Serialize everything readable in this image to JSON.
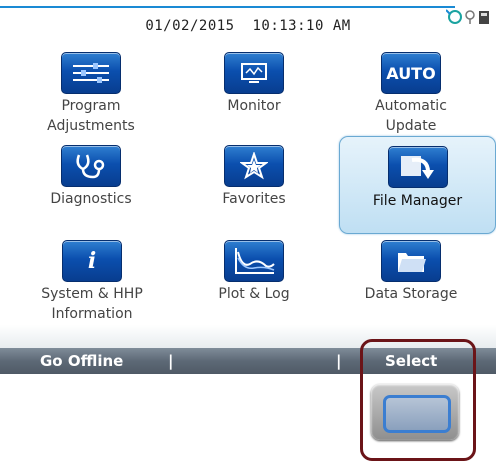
{
  "status": {
    "datetime": "01/02/2015  10:13:10 AM"
  },
  "tiles": [
    {
      "label": "Program\nAdjustments",
      "icon": "sliders-icon"
    },
    {
      "label": "Monitor",
      "icon": "monitor-icon"
    },
    {
      "label": "Automatic\nUpdate",
      "icon": "auto-icon",
      "icon_text": "AUTO"
    },
    {
      "label": "Diagnostics",
      "icon": "stethoscope-icon"
    },
    {
      "label": "Favorites",
      "icon": "star-icon"
    },
    {
      "label": "File Manager",
      "icon": "folder-arrow-icon",
      "selected": true
    },
    {
      "label": "System & HHP\nInformation",
      "icon": "info-icon",
      "icon_text": "i"
    },
    {
      "label": "Plot & Log",
      "icon": "plot-icon"
    },
    {
      "label": "Data Storage",
      "icon": "folder-icon"
    }
  ],
  "softkeys": {
    "left": "Go Offline",
    "right": "Select",
    "separator": "|"
  },
  "colors": {
    "accent": "#0b4fae",
    "highlight": "#6b1418"
  }
}
